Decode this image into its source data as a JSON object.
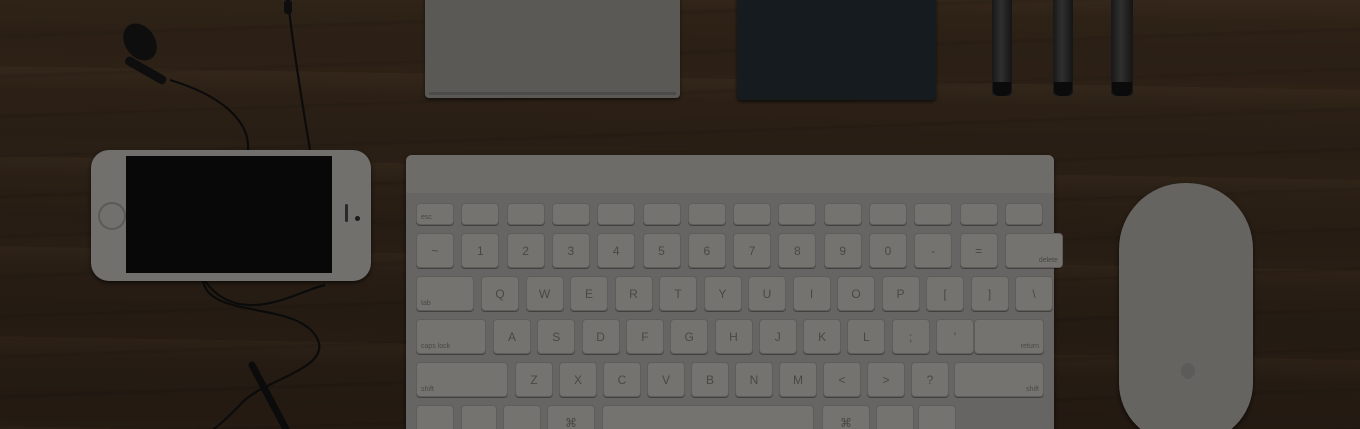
{
  "scene": "desk",
  "keyboard": {
    "fn_row": [
      "esc",
      "",
      "",
      "",
      "",
      "",
      "",
      "",
      "",
      "",
      "",
      "",
      "",
      ""
    ],
    "num_row": [
      "~",
      "1",
      "2",
      "3",
      "4",
      "5",
      "6",
      "7",
      "8",
      "9",
      "0",
      "-",
      "=",
      "delete"
    ],
    "num_row_shift": [
      "`",
      "!",
      "@",
      "#",
      "$",
      "%",
      "^",
      "&",
      "*",
      "(",
      ")",
      "—",
      "+",
      ""
    ],
    "qwerty_row": [
      "tab",
      "Q",
      "W",
      "E",
      "R",
      "T",
      "Y",
      "U",
      "I",
      "O",
      "P",
      "[",
      "]",
      "\\"
    ],
    "home_row": [
      "caps lock",
      "A",
      "S",
      "D",
      "F",
      "G",
      "H",
      "J",
      "K",
      "L",
      ";",
      "'",
      "return"
    ],
    "shift_row": [
      "shift",
      "Z",
      "X",
      "C",
      "V",
      "B",
      "N",
      "M",
      "<",
      ">",
      "?",
      "shift"
    ],
    "bottom_row": [
      "",
      "",
      "",
      "⌘",
      "",
      "⌘",
      "",
      ""
    ]
  },
  "colors": {
    "wood": "#3a2b1d",
    "device_silver": "#8f8d89",
    "notebook": "#1c2127",
    "screen": "#0a0a0a"
  },
  "icons": [
    "earphones-icon",
    "phone-icon",
    "keyboard-icon",
    "mouse-icon",
    "pen-icon",
    "notebook-icon"
  ]
}
